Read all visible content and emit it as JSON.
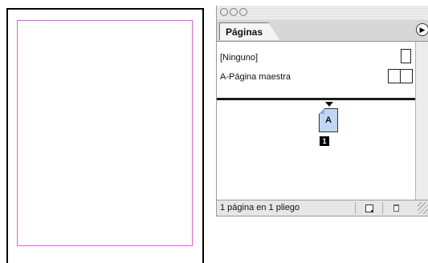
{
  "panel": {
    "tab_label": "Páginas",
    "menu_icon": "triangle-right-icon",
    "masters": [
      {
        "label": "[Ninguno]",
        "icon": "single-page-icon"
      },
      {
        "label": "A-Página maestra",
        "icon": "facing-pages-icon"
      }
    ],
    "page": {
      "master_letter": "A",
      "number": "1"
    },
    "status_text": "1 página en 1 pliego",
    "buttons": {
      "new_page": "new-page-icon",
      "delete_page": "trash-icon"
    }
  },
  "colors": {
    "margin_guide": "#e05ce5",
    "page_thumbnail": "#bfd7f4"
  }
}
